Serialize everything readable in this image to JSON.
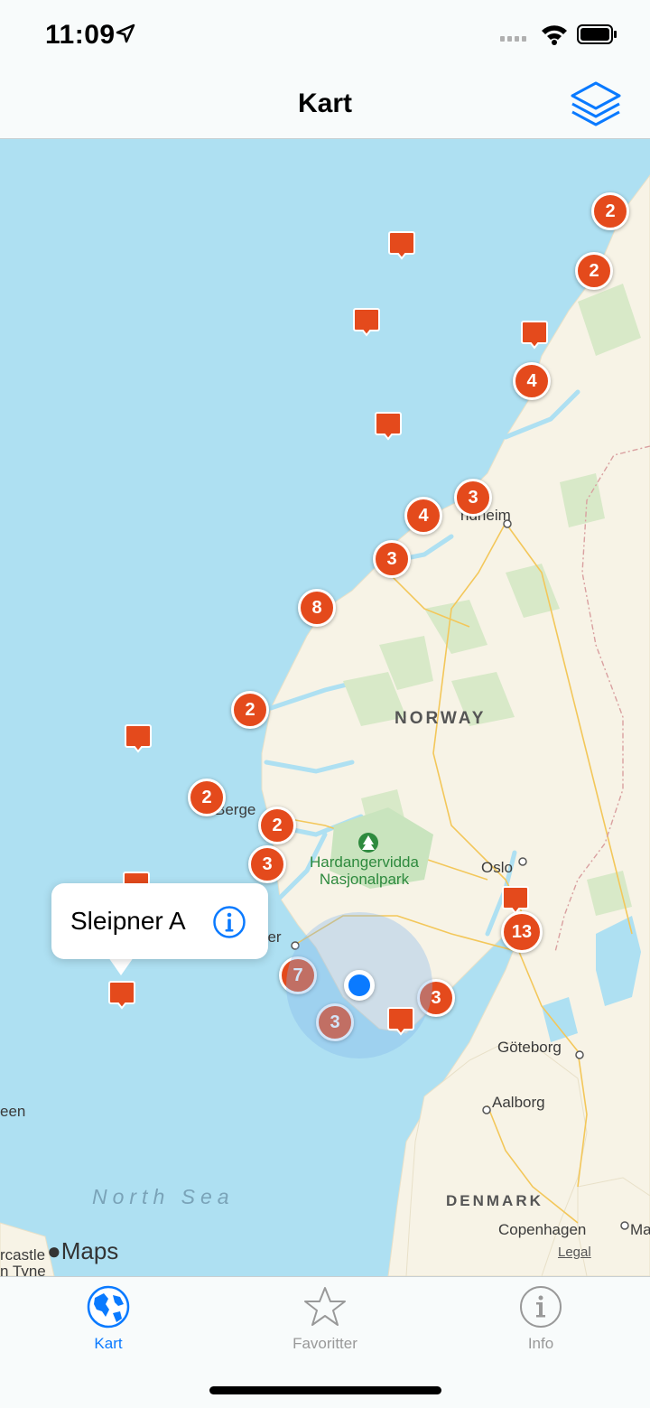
{
  "status": {
    "time": "11:09"
  },
  "nav": {
    "title": "Kart"
  },
  "map": {
    "labels": {
      "trondheim": "ndheim",
      "norway": "NORWAY",
      "bergen": "Berge",
      "stavanger": "ger",
      "park": "Hardangervidda\nNasjonalpark",
      "oslo": "Oslo",
      "goteborg": "Göteborg",
      "aalborg": "Aalborg",
      "denmark": "DENMARK",
      "copenhagen": "Copenhagen",
      "malmo": "Ma",
      "north_sea": "North Sea",
      "aberdeen": "een",
      "newcastle1": "rcastle",
      "newcastle2": "n Tyne"
    },
    "clusters": [
      "2",
      "2",
      "4",
      "3",
      "4",
      "3",
      "8",
      "2",
      "2",
      "2",
      "3",
      "13",
      "7",
      "3",
      "3"
    ],
    "callout": {
      "title": "Sleipner A"
    },
    "maps_logo": "Maps",
    "legal": "Legal"
  },
  "tabs": [
    {
      "label": "Kart",
      "active": true
    },
    {
      "label": "Favoritter",
      "active": false
    },
    {
      "label": "Info",
      "active": false
    }
  ],
  "colors": {
    "accent": "#0a7aff",
    "marker": "#e44a1c",
    "water": "#aee0f2",
    "land": "#f7f3e6"
  }
}
